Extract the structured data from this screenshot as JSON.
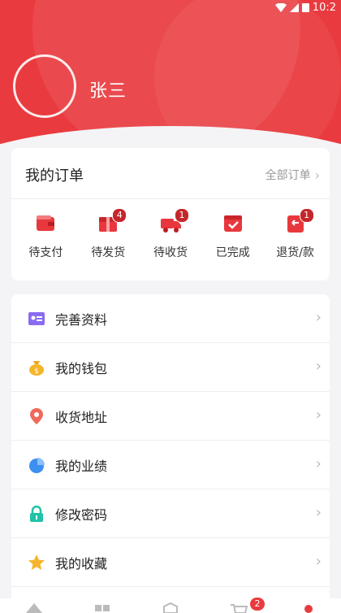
{
  "status": {
    "time": "10:2"
  },
  "profile": {
    "name": "张三"
  },
  "orders": {
    "title": "我的订单",
    "all_label": "全部订单",
    "items": [
      {
        "label": "待支付",
        "badge": null,
        "icon": "wallet-icon"
      },
      {
        "label": "待发货",
        "badge": "4",
        "icon": "package-icon"
      },
      {
        "label": "待收货",
        "badge": "1",
        "icon": "truck-icon"
      },
      {
        "label": "已完成",
        "badge": null,
        "icon": "check-box-icon"
      },
      {
        "label": "退货/款",
        "badge": "1",
        "icon": "return-icon"
      }
    ]
  },
  "menu": [
    {
      "label": "完善资料",
      "icon": "id-card-icon"
    },
    {
      "label": "我的钱包",
      "icon": "money-bag-icon"
    },
    {
      "label": "收货地址",
      "icon": "location-pin-icon"
    },
    {
      "label": "我的业绩",
      "icon": "pie-chart-icon"
    },
    {
      "label": "修改密码",
      "icon": "lock-icon"
    },
    {
      "label": "我的收藏",
      "icon": "star-icon"
    }
  ],
  "tabbar": {
    "cart_badge": "2"
  },
  "colors": {
    "brand": "#e93b3f",
    "badge": "#c5262b"
  }
}
